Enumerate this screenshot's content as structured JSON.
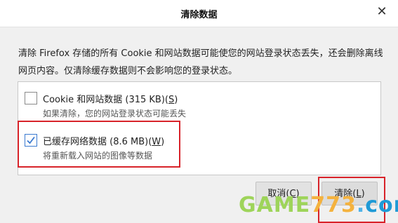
{
  "window": {
    "title": "清除数据",
    "close_glyph": "✕"
  },
  "description": "清除 Firefox 存储的所有 Cookie 和网站数据可能使您的网站登录状态丢失，还会删除离线网页内容。仅清除缓存数据则不会影响您的登录状态。",
  "options": [
    {
      "label": "Cookie 和网站数据 (315 KB)(",
      "accesskey": "S",
      "label_end": ")",
      "sublabel": "如果清除，您的网站登录状态可能丢失",
      "checked": false
    },
    {
      "label": "已缓存网络数据 (8.6 MB)(",
      "accesskey": "W",
      "label_end": ")",
      "sublabel": "将重新载入网站的图像等数据",
      "checked": true
    }
  ],
  "buttons": {
    "cancel_label": "取消(",
    "cancel_key": "C",
    "cancel_end": ")",
    "clear_label": "清除(",
    "clear_key": "L",
    "clear_end": ")"
  },
  "watermark": {
    "part1": "GAME",
    "part2": "773",
    "part3": ".",
    "part4": "com"
  },
  "colors": {
    "highlight_border": "#d8232a",
    "checkbox_accent": "#3b7ad0"
  }
}
